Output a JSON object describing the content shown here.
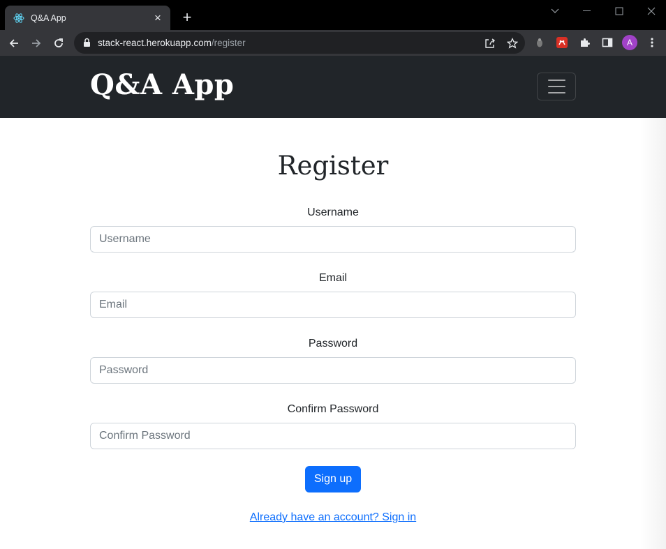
{
  "browser": {
    "tab_title": "Q&A App",
    "tab_close": "×",
    "new_tab": "+",
    "url_host": "stack-react.herokuapp.com",
    "url_path": "/register",
    "profile_initial": "A"
  },
  "navbar": {
    "brand": "Q&A App"
  },
  "form": {
    "heading": "Register",
    "fields": [
      {
        "label": "Username",
        "placeholder": "Username"
      },
      {
        "label": "Email",
        "placeholder": "Email"
      },
      {
        "label": "Password",
        "placeholder": "Password"
      },
      {
        "label": "Confirm Password",
        "placeholder": "Confirm Password"
      }
    ],
    "submit_label": "Sign up",
    "signin_link": "Already have an account? Sign in"
  },
  "colors": {
    "navbar_bg": "#212529",
    "primary": "#0d6efd",
    "avatar": "#a142c7"
  }
}
